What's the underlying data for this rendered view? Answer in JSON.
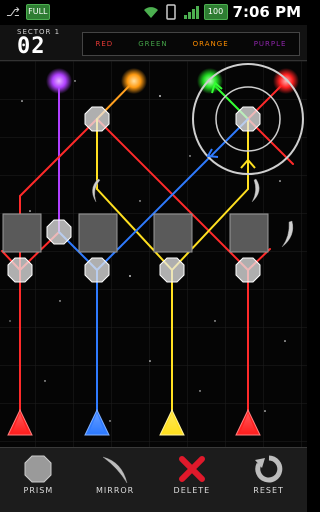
{
  "status_bar": {
    "battery_left": "FULL",
    "battery_right": "100",
    "time": "7:06 PM"
  },
  "header": {
    "sector_label": "SECTOR 1",
    "sector_number": "02",
    "legend": [
      {
        "label": "RED",
        "color": "#e53935"
      },
      {
        "label": "GREEN",
        "color": "#43a047"
      },
      {
        "label": "ORANGE",
        "color": "#fb8c00"
      },
      {
        "label": "PURPLE",
        "color": "#8e24aa"
      }
    ]
  },
  "beam_colors": {
    "red": "#ff2a2a",
    "green": "#33ff33",
    "orange": "#ffa020",
    "purple": "#b040ff",
    "blue": "#2f7bff",
    "yellow": "#ffe020"
  },
  "toolbar": {
    "prism": "PRISM",
    "mirror": "MIRROR",
    "delete": "DELETE",
    "reset": "RESET"
  }
}
